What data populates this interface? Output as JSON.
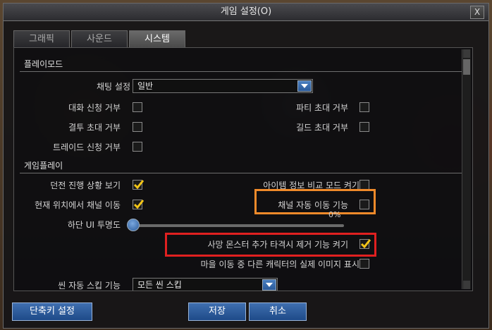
{
  "window": {
    "title": "게임 설정(O)",
    "close_label": "X"
  },
  "tabs": [
    {
      "label": "그래픽"
    },
    {
      "label": "사운드"
    },
    {
      "label": "시스템"
    }
  ],
  "sections": {
    "play_mode": "플레이모드",
    "game_play": "게임플레이"
  },
  "play_mode": {
    "chat_setting_label": "채팅 설정",
    "chat_setting_value": "일반",
    "duel_refuse": {
      "label": "대화 신청 거부",
      "checked": false
    },
    "party_invite_refuse": {
      "label": "파티 초대 거부",
      "checked": false
    },
    "duel_invite_refuse": {
      "label": "결투 초대 거부",
      "checked": false
    },
    "guild_invite_refuse": {
      "label": "길드 초대 거부",
      "checked": false
    },
    "trade_refuse": {
      "label": "트레이드 신청 거부",
      "checked": false
    }
  },
  "game_play": {
    "dungeon_progress": {
      "label": "던전 진행 상황 보기",
      "checked": true
    },
    "item_compare": {
      "label": "아이템 정보 비교 모드 켜기",
      "checked": false
    },
    "channel_move_here": {
      "label": "현재 위치에서 채널 이동",
      "checked": true
    },
    "auto_channel_move": {
      "label": "채널 자동 이동 기능",
      "checked": false
    },
    "ui_transparency_label": "하단 UI 투명도",
    "ui_transparency_value": "0%",
    "death_monster_remove": {
      "label": "사망 몬스터 추가 타격시 제거 기능 켜기",
      "checked": true
    },
    "town_real_image": {
      "label": "마을 이동 중 다른 캐릭터의 실제 이미지 표시",
      "checked": false
    },
    "scene_skip_label": "씬 자동 스킵 기능",
    "scene_skip_value": "모든 씬 스킵"
  },
  "buttons": {
    "hotkey": "단축키 설정",
    "save": "저장",
    "cancel": "취소"
  },
  "colors": {
    "accent_blue": "#2a5a9a",
    "highlight_orange": "#f08a2a",
    "highlight_red": "#e02020",
    "check_yellow": "#f2c418"
  }
}
